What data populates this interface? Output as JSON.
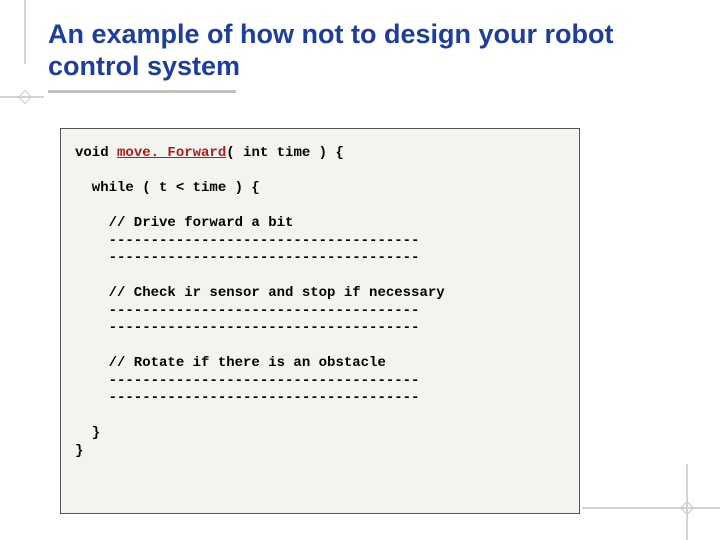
{
  "slide": {
    "title": "An example of how not to design your robot control system",
    "code": {
      "sig_prefix": "void ",
      "fn_name": "move. Forward",
      "sig_suffix": "( int time ) {",
      "while_line": "  while ( t < time ) {",
      "comment_drive": "    // Drive forward a bit",
      "dashes1a": "    -------------------------------------",
      "dashes1b": "    -------------------------------------",
      "comment_check": "    // Check ir sensor and stop if necessary",
      "dashes2a": "    -------------------------------------",
      "dashes2b": "    -------------------------------------",
      "comment_rotate": "    // Rotate if there is an obstacle",
      "dashes3a": "    -------------------------------------",
      "dashes3b": "    -------------------------------------",
      "close_inner": "  }",
      "close_outer": "}"
    }
  }
}
